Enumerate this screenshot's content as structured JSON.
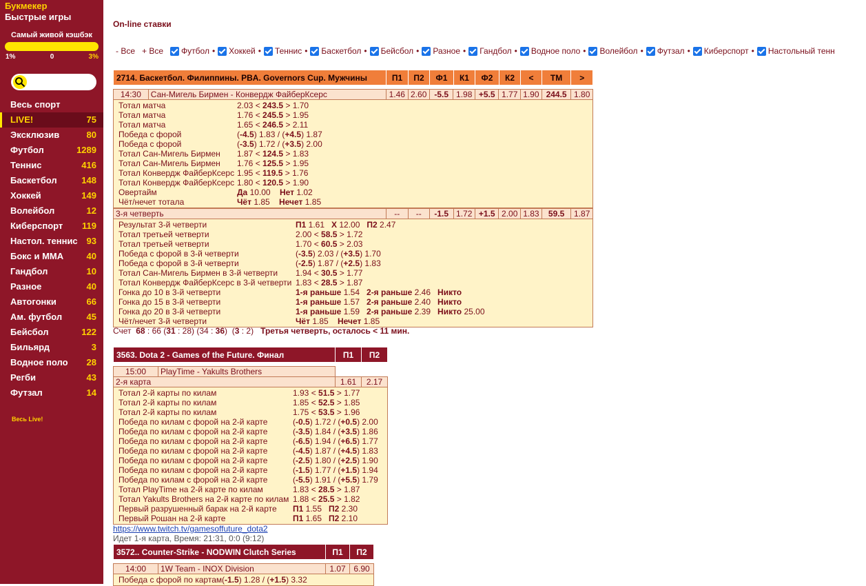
{
  "sidebar": {
    "nav1": "Букмекер",
    "nav2": "Быстрые игры",
    "cashback": {
      "title": "Самый живой кэшбэк",
      "min": "1%",
      "mid": "0",
      "max": "3%"
    },
    "sports": [
      {
        "label": "Весь спорт",
        "count": ""
      },
      {
        "label": "LIVE!",
        "count": "75"
      },
      {
        "label": "Эксклюзив",
        "count": "80"
      },
      {
        "label": "Футбол",
        "count": "1289"
      },
      {
        "label": "Теннис",
        "count": "416"
      },
      {
        "label": "Баскетбол",
        "count": "148"
      },
      {
        "label": "Хоккей",
        "count": "149"
      },
      {
        "label": "Волейбол",
        "count": "12"
      },
      {
        "label": "Киберспорт",
        "count": "119"
      },
      {
        "label": "Настол. теннис",
        "count": "93"
      },
      {
        "label": "Бокс и MMA",
        "count": "40"
      },
      {
        "label": "Гандбол",
        "count": "10"
      },
      {
        "label": "Разное",
        "count": "40"
      },
      {
        "label": "Автогонки",
        "count": "66"
      },
      {
        "label": "Ам. футбол",
        "count": "45"
      },
      {
        "label": "Бейсбол",
        "count": "122"
      },
      {
        "label": "Бильярд",
        "count": "3"
      },
      {
        "label": "Водное поло",
        "count": "28"
      },
      {
        "label": "Регби",
        "count": "43"
      },
      {
        "label": "Футзал",
        "count": "14"
      }
    ],
    "all_live": "Весь Live!"
  },
  "main": {
    "title": "On-line ставки",
    "minus_all": "- Все",
    "plus_all": "+ Все",
    "filters": [
      "Футбол",
      "Хоккей",
      "Теннис",
      "Баскетбол",
      "Бейсбол",
      "Разное",
      "Гандбол",
      "Водное поло",
      "Волейбол",
      "Футзал",
      "Киберспорт",
      "Настольный тенн"
    ]
  },
  "ev1": {
    "title": "2714. Баскетбол. Филиппины. PBA. Governors Cup. Мужчины",
    "cols": [
      "П1",
      "П2",
      "Ф1",
      "К1",
      "Ф2",
      "К2",
      "<",
      "ТМ",
      ">"
    ],
    "match": {
      "time": "14:30",
      "name": "Сан-Мигель Бирмен - Конвердж ФайберКсерс",
      "odds": [
        "1.46",
        "2.60",
        "-5.5",
        "1.98",
        "+5.5",
        "1.77",
        "1.90",
        "244.5",
        "1.80"
      ]
    },
    "rows": [
      {
        "l": "Тотал матча",
        "a": "2.03 < ",
        "b": "243.5",
        "c": " > 1.70"
      },
      {
        "l": "Тотал матча",
        "a": "1.76 < ",
        "b": "245.5",
        "c": " > 1.95"
      },
      {
        "l": "Тотал матча",
        "a": "1.65 < ",
        "b": "246.5",
        "c": " > 2.11"
      },
      {
        "l": "Победа с форой",
        "a": "(",
        "b": "-4.5",
        "c": ") 1.83 / (",
        "d": "+4.5",
        "e": ") 1.87"
      },
      {
        "l": "Победа с форой",
        "a": "(",
        "b": "-3.5",
        "c": ") 1.72 / (",
        "d": "+3.5",
        "e": ") 2.00"
      },
      {
        "l": "Тотал Сан-Мигель Бирмен",
        "a": "1.87 < ",
        "b": "124.5",
        "c": " > 1.83"
      },
      {
        "l": "Тотал Сан-Мигель Бирмен",
        "a": "1.76 < ",
        "b": "125.5",
        "c": " > 1.95"
      },
      {
        "l": "Тотал Конвердж ФайберКсерс",
        "a": "1.95 < ",
        "b": "119.5",
        "c": " > 1.76"
      },
      {
        "l": "Тотал Конвердж ФайберКсерс",
        "a": "1.80 < ",
        "b": "120.5",
        "c": " > 1.90"
      },
      {
        "l": "Овертайм",
        "a": "",
        "b": "Да",
        "c": " 10.00    ",
        "d": "Нет",
        "e": " 1.02"
      },
      {
        "l": "Чёт/нечет тотала",
        "a": "",
        "b": "Чёт",
        "c": " 1.85    ",
        "d": "Нечет",
        "e": " 1.85"
      }
    ],
    "q3": {
      "name": "3-я четверть",
      "odds": [
        "--",
        "--",
        "-1.5",
        "1.72",
        "+1.5",
        "2.00",
        "1.83",
        "59.5",
        "1.87"
      ]
    },
    "rows2": [
      {
        "l": "Результат 3-й четверти",
        "a": "",
        "b": "П1",
        "c": " 1.61   ",
        "d": "Х",
        "e": " 12.00   ",
        "f": "П2",
        "g": " 2.47"
      },
      {
        "l": "Тотал третьей четверти",
        "a": "2.00 < ",
        "b": "58.5",
        "c": " > 1.72"
      },
      {
        "l": "Тотал третьей четверти",
        "a": "1.70 < ",
        "b": "60.5",
        "c": " > 2.03"
      },
      {
        "l": "Победа с форой в 3-й четверти",
        "a": "(",
        "b": "-3.5",
        "c": ") 2.03 / (",
        "d": "+3.5",
        "e": ") 1.70"
      },
      {
        "l": "Победа с форой в 3-й четверти",
        "a": "(",
        "b": "-2.5",
        "c": ") 1.87 / (",
        "d": "+2.5",
        "e": ") 1.83"
      },
      {
        "l": "Тотал Сан-Мигель Бирмен в 3-й четверти",
        "a": "1.94 < ",
        "b": "30.5",
        "c": " > 1.77"
      },
      {
        "l": "Тотал Конвердж ФайберКсерс в 3-й четверти",
        "a": "1.83 < ",
        "b": "28.5",
        "c": " > 1.87"
      },
      {
        "l": "Гонка до 10 в 3-й четверти",
        "a": "",
        "b": "1-я раньше",
        "c": " 1.54   ",
        "d": "2-я раньше",
        "e": " 2.46   ",
        "f": "Никто",
        "g": ""
      },
      {
        "l": "Гонка до 15 в 3-й четверти",
        "a": "",
        "b": "1-я раньше",
        "c": " 1.57   ",
        "d": "2-я раньше",
        "e": " 2.40   ",
        "f": "Никто",
        "g": ""
      },
      {
        "l": "Гонка до 20 в 3-й четверти",
        "a": "",
        "b": "1-я раньше",
        "c": " 1.59   ",
        "d": "2-я раньше",
        "e": " 2.39   ",
        "f": "Никто",
        "g": " 25.00"
      },
      {
        "l": "Чёт/нечет 3-й четверти",
        "a": "",
        "b": "Чёт",
        "c": " 1.85    ",
        "d": "Нечет",
        "e": " 1.85"
      }
    ],
    "score_label": "Счет",
    "score": "68",
    "score2": " : 66  (",
    "s31": "31",
    "s28": " : 28)  (34 : ",
    "s36": "36",
    "s3": "3",
    "s2": " : 2)",
    "status": "Третья четверть, осталось < 11 мин."
  },
  "ev2": {
    "title": "3563. Dota 2 - Games of the Future. Финал",
    "cols": [
      "П1",
      "П2"
    ],
    "match": {
      "time": "15:00",
      "name": "PlayTime - Yakults Brothers"
    },
    "map": {
      "name": "2-я карта",
      "odds": [
        "1.61",
        "2.17"
      ]
    },
    "rows": [
      {
        "l": "Тотал 2-й карты по килам",
        "a": "1.93 < ",
        "b": "51.5",
        "c": " > 1.77"
      },
      {
        "l": "Тотал 2-й карты по килам",
        "a": "1.85 < ",
        "b": "52.5",
        "c": " > 1.85"
      },
      {
        "l": "Тотал 2-й карты по килам",
        "a": "1.75 < ",
        "b": "53.5",
        "c": " > 1.96"
      },
      {
        "l": "Победа по килам с форой на 2-й карте",
        "a": "(",
        "b": "-0.5",
        "c": ") 1.72 / (",
        "d": "+0.5",
        "e": ") 2.00"
      },
      {
        "l": "Победа по килам с форой на 2-й карте",
        "a": "(",
        "b": "-3.5",
        "c": ") 1.84 / (",
        "d": "+3.5",
        "e": ") 1.86"
      },
      {
        "l": "Победа по килам с форой на 2-й карте",
        "a": "(",
        "b": "-6.5",
        "c": ") 1.94 / (",
        "d": "+6.5",
        "e": ") 1.77"
      },
      {
        "l": "Победа по килам с форой на 2-й карте",
        "a": "(",
        "b": "-4.5",
        "c": ") 1.87 / (",
        "d": "+4.5",
        "e": ") 1.83"
      },
      {
        "l": "Победа по килам с форой на 2-й карте",
        "a": "(",
        "b": "-2.5",
        "c": ") 1.80 / (",
        "d": "+2.5",
        "e": ") 1.90"
      },
      {
        "l": "Победа по килам с форой на 2-й карте",
        "a": "(",
        "b": "-1.5",
        "c": ") 1.77 / (",
        "d": "+1.5",
        "e": ") 1.94"
      },
      {
        "l": "Победа по килам с форой на 2-й карте",
        "a": "(",
        "b": "-5.5",
        "c": ") 1.91 / (",
        "d": "+5.5",
        "e": ") 1.79"
      },
      {
        "l": "Тотал PlayTime на 2-й карте по килам",
        "a": "1.83 < ",
        "b": "28.5",
        "c": " > 1.87"
      },
      {
        "l": "Тотал Yakults Brothers на 2-й карте по килам",
        "a": "1.88 < ",
        "b": "25.5",
        "c": " > 1.82"
      },
      {
        "l": "Первый разрушенный барак на 2-й карте",
        "a": "",
        "b": "П1",
        "c": " 1.55   ",
        "d": "П2",
        "e": " 2.30"
      },
      {
        "l": "Первый Рошан на 2-й карте",
        "a": "",
        "b": "П1",
        "c": " 1.65   ",
        "d": "П2",
        "e": " 2.10"
      }
    ],
    "link": "https://www.twitch.tv/gamesoffuture_dota2",
    "status": "Идет 1-я карта, Время: 21:31, 0:0 (9:12)"
  },
  "ev3": {
    "title": "3572.. Counter-Strike - NODWIN Clutch Series",
    "cols": [
      "П1",
      "П2"
    ],
    "match": {
      "time": "14:00",
      "name": "1W Team - INOX Division",
      "odds": [
        "1.07",
        "6.90"
      ]
    },
    "row": {
      "l": "Победа с форой по картам ",
      "a": "(",
      "b": "-1.5",
      "c": ") 1.28 / (",
      "d": "+1.5",
      "e": ") 3.32"
    }
  },
  "colors": {
    "sidebar": "#8e1628",
    "accent": "#ffd200",
    "header": "#f07e3a",
    "box": "#fff3c8"
  }
}
